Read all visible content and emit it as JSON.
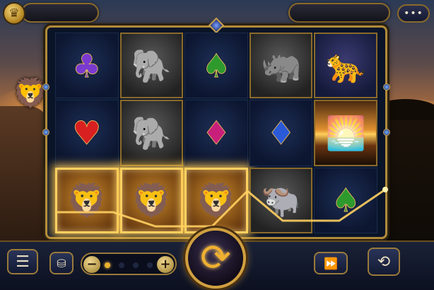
{
  "header": {
    "left_panel_text": "",
    "right_panel_text": "",
    "crown_icon": "♛",
    "menu_icon": "•••"
  },
  "reels": [
    [
      {
        "name": "club",
        "type": "suit",
        "glyph": "♣"
      },
      {
        "name": "heart",
        "type": "suit",
        "glyph": "♥"
      },
      {
        "name": "lion",
        "type": "win",
        "glyph": "🦁"
      }
    ],
    [
      {
        "name": "elephant",
        "type": "photo",
        "glyph": "🐘"
      },
      {
        "name": "elephant",
        "type": "photo",
        "glyph": "🐘"
      },
      {
        "name": "lion",
        "type": "win",
        "glyph": "🦁"
      }
    ],
    [
      {
        "name": "spade",
        "type": "suit",
        "glyph": "♠"
      },
      {
        "name": "diamond",
        "type": "suit",
        "glyph": "♦"
      },
      {
        "name": "lion",
        "type": "win",
        "glyph": "🦁"
      }
    ],
    [
      {
        "name": "rhino",
        "type": "photo",
        "glyph": "🦏"
      },
      {
        "name": "diamond",
        "type": "suit",
        "glyph": "♦"
      },
      {
        "name": "buffalo",
        "type": "photo",
        "glyph": "🐃"
      }
    ],
    [
      {
        "name": "leopard",
        "type": "photo",
        "glyph": "🐆"
      },
      {
        "name": "sunset",
        "type": "photo",
        "glyph": "🌅"
      },
      {
        "name": "spade",
        "type": "suit",
        "glyph": "♠"
      }
    ]
  ],
  "extra_win_cell": {
    "name": "lion",
    "glyph": "🦁"
  },
  "controls": {
    "menu_icon": "☰",
    "coins_icon": "⛁",
    "bet_minus": "−",
    "bet_plus": "+",
    "bet_level": 1,
    "bet_levels": 4,
    "spin_icon": "⟳",
    "turbo_icon": "⏩",
    "autoplay_icon": "⟲"
  },
  "colors": {
    "gold": "#d0a040",
    "payline": "#ffd060"
  }
}
